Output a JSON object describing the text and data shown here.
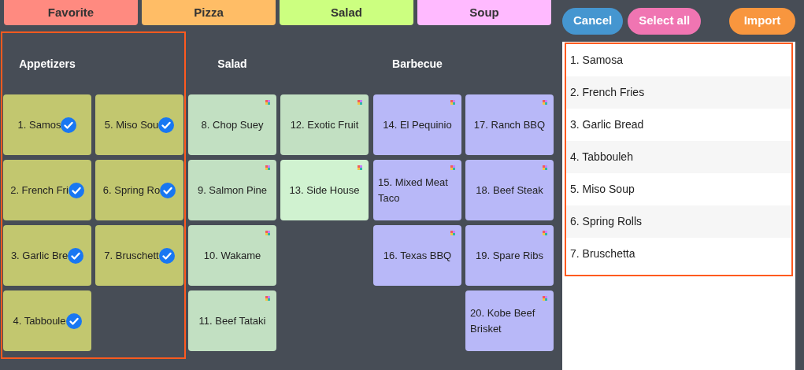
{
  "tabs": [
    {
      "label": "Favorite",
      "color": "#ff8a80"
    },
    {
      "label": "Pizza",
      "color": "#ffbd66"
    },
    {
      "label": "Salad",
      "color": "#ccff80"
    },
    {
      "label": "Soup",
      "color": "#ffbaff"
    }
  ],
  "groups": [
    {
      "title": "Appetizers",
      "selected": true,
      "columns": [
        [
          {
            "label": "1. Samos",
            "checked": true,
            "color": "#c2c76f"
          },
          {
            "label": "2. French Fri",
            "checked": true,
            "color": "#c2c76f"
          },
          {
            "label": "3. Garlic Bre",
            "checked": true,
            "color": "#c2c76f"
          },
          {
            "label": "4. Tabboule",
            "checked": true,
            "color": "#c2c76f"
          }
        ],
        [
          {
            "label": "5. Miso Sou",
            "checked": true,
            "color": "#c2c76f"
          },
          {
            "label": "6. Spring Ro",
            "checked": true,
            "color": "#c2c76f"
          },
          {
            "label": "7. Bruschett",
            "checked": true,
            "color": "#c2c76f"
          }
        ]
      ]
    },
    {
      "title": "Salad",
      "selected": false,
      "columns": [
        [
          {
            "label": "8. Chop Suey",
            "checked": false,
            "color": "#c2e0c2"
          },
          {
            "label": "9. Salmon Pine",
            "checked": false,
            "color": "#c2e0c2"
          },
          {
            "label": "10. Wakame",
            "checked": false,
            "color": "#c2e0c2"
          },
          {
            "label": "11. Beef Tataki",
            "checked": false,
            "color": "#c2e0c2"
          }
        ],
        [
          {
            "label": "12. Exotic Fruit",
            "checked": false,
            "color": "#c2e0c2"
          },
          {
            "label": "13. Side House",
            "checked": false,
            "color": "#d0f2d0"
          }
        ]
      ]
    },
    {
      "title": "Barbecue",
      "selected": false,
      "columns": [
        [
          {
            "label": "14. El Pequinio",
            "checked": false,
            "color": "#b8b8f8"
          },
          {
            "label": "15. Mixed Meat Taco",
            "checked": false,
            "color": "#b8b8f8"
          },
          {
            "label": "16. Texas BBQ",
            "checked": false,
            "color": "#b8b8f8"
          }
        ],
        [
          {
            "label": "17. Ranch BBQ",
            "checked": false,
            "color": "#b8b8f8"
          },
          {
            "label": "18. Beef Steak",
            "checked": false,
            "color": "#b8b8f8"
          },
          {
            "label": "19. Spare Ribs",
            "checked": false,
            "color": "#b8b8f8"
          },
          {
            "label": "20. Kobe Beef Brisket",
            "checked": false,
            "color": "#b8b8f8"
          }
        ]
      ]
    }
  ],
  "actions": [
    {
      "label": "Cancel",
      "color": "#4596d0"
    },
    {
      "label": "Select all",
      "color": "#f075b2"
    },
    {
      "label": "Import",
      "color": "#f8963e"
    }
  ],
  "selected_items": [
    "1. Samosa",
    "2. French Fries",
    "3. Garlic Bread",
    "4. Tabbouleh",
    "5. Miso Soup",
    "6. Spring Rolls",
    "7. Bruschetta"
  ]
}
